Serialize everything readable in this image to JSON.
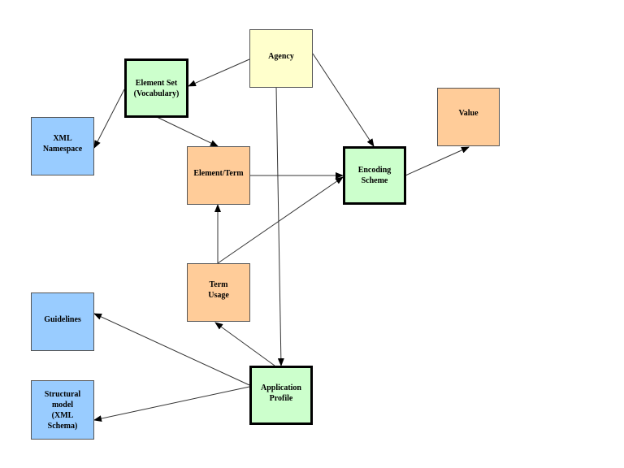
{
  "colors": {
    "agency": "#ffffcc",
    "green": "#ccffcc",
    "orange": "#ffcc99",
    "blue": "#99ccff"
  },
  "nodes": {
    "agency": "Agency",
    "element_set": "Element Set\n(Vocabulary)",
    "xml_namespace": "XML\nNamespace",
    "element_term": "Element/Term",
    "encoding_scheme": "Encoding\nScheme",
    "value": "Value",
    "term_usage": "Term\nUsage",
    "guidelines": "Guidelines",
    "structural_model": "Structural\nmodel\n(XML\nSchema)",
    "application_profile": "Application\nProfile"
  },
  "edges": [
    {
      "from": "agency",
      "to": "element_set"
    },
    {
      "from": "agency",
      "to": "encoding_scheme"
    },
    {
      "from": "agency",
      "to": "application_profile"
    },
    {
      "from": "element_set",
      "to": "xml_namespace"
    },
    {
      "from": "element_set",
      "to": "element_term"
    },
    {
      "from": "element_term",
      "to": "encoding_scheme"
    },
    {
      "from": "encoding_scheme",
      "to": "value"
    },
    {
      "from": "term_usage",
      "to": "element_term"
    },
    {
      "from": "term_usage",
      "to": "encoding_scheme"
    },
    {
      "from": "application_profile",
      "to": "term_usage"
    },
    {
      "from": "application_profile",
      "to": "guidelines"
    },
    {
      "from": "application_profile",
      "to": "structural_model"
    }
  ]
}
